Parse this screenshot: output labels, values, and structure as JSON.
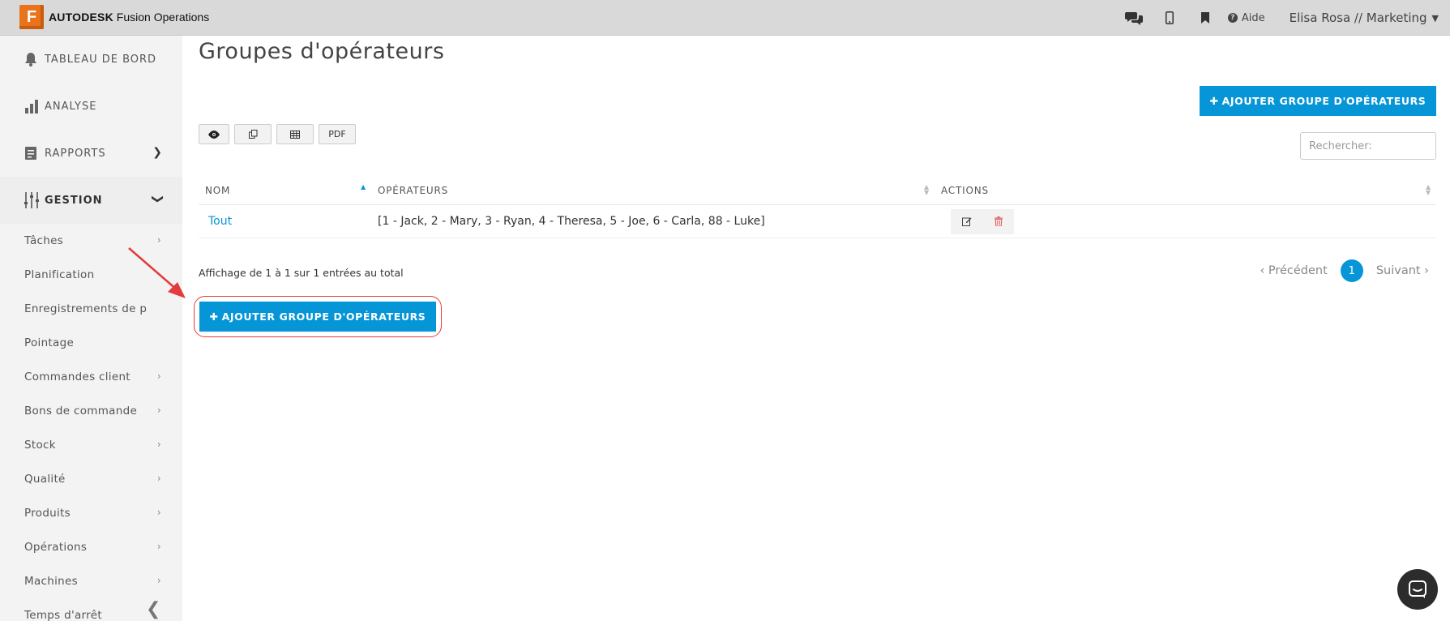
{
  "topbar": {
    "logo_letter": "F",
    "brand": "AUTODESK",
    "product": "Fusion Operations",
    "icons": [
      "chat-icon",
      "mobile-icon",
      "bookmark-icon"
    ],
    "help_label": "Aide",
    "user_label": "Elisa Rosa // Marketing"
  },
  "sidebar": {
    "main_items": [
      {
        "label": "TABLEAU DE BORD",
        "icon": "bell-icon"
      },
      {
        "label": "ANALYSE",
        "icon": "bar-chart-icon"
      },
      {
        "label": "RAPPORTS",
        "icon": "report-icon"
      },
      {
        "label": "GESTION",
        "icon": "sliders-icon"
      }
    ],
    "sub_items": [
      {
        "label": "Tâches"
      },
      {
        "label": "Planification"
      },
      {
        "label": "Enregistrements de production"
      },
      {
        "label": "Pointage"
      },
      {
        "label": "Commandes client"
      },
      {
        "label": "Bons de commande"
      },
      {
        "label": "Stock"
      },
      {
        "label": "Qualité"
      },
      {
        "label": "Produits"
      },
      {
        "label": "Opérations"
      },
      {
        "label": "Machines"
      },
      {
        "label": "Temps d'arrêt"
      }
    ]
  },
  "main": {
    "title": "Groupes d'opérateurs",
    "add_button_label": "AJOUTER GROUPE D'OPÉRATEURS",
    "export_buttons": {
      "pdf": "PDF"
    },
    "search_placeholder": "Rechercher:",
    "table": {
      "headers": [
        "NOM",
        "OPÉRATEURS",
        "ACTIONS"
      ],
      "rows": [
        {
          "name": "Tout",
          "operators": "[1 - Jack, 2 - Mary, 3 - Ryan, 4 - Theresa, 5 - Joe, 6 - Carla, 88 - Luke]"
        }
      ]
    },
    "info": "Affichage de 1 à 1 sur 1 entrées au total",
    "pagination": {
      "prev": "Précédent",
      "page": "1",
      "next": "Suivant"
    }
  },
  "colors": {
    "accent": "#0696d7",
    "annotation": "#e23c3c",
    "logo": "#e8731b"
  }
}
